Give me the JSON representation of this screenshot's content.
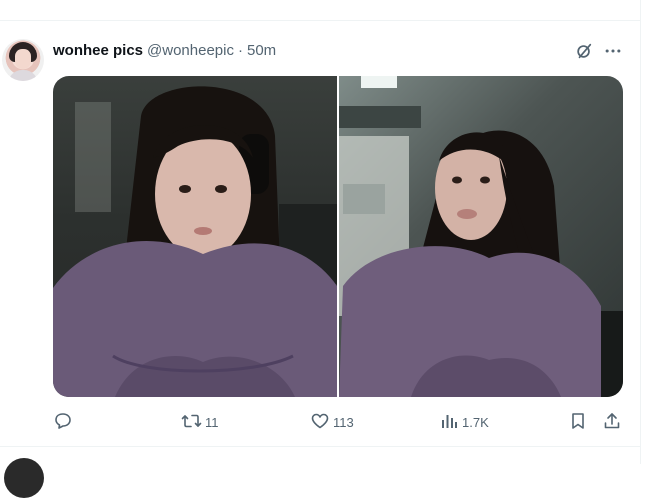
{
  "tweet": {
    "display_name": "wonhee pics",
    "handle": "@wonheepic",
    "separator": "·",
    "time": "50m",
    "actions": {
      "retweets": "11",
      "likes": "113",
      "views": "1.7K"
    }
  },
  "icons": {
    "grok": "grok-icon",
    "more": "more-icon",
    "reply": "reply-icon",
    "retweet": "retweet-icon",
    "like": "like-icon",
    "views": "views-icon",
    "bookmark": "bookmark-icon",
    "share": "share-icon"
  },
  "colors": {
    "text_primary": "#0f1419",
    "text_secondary": "#536471",
    "divider": "#eff3f4",
    "sweater": "#6a5a78"
  }
}
